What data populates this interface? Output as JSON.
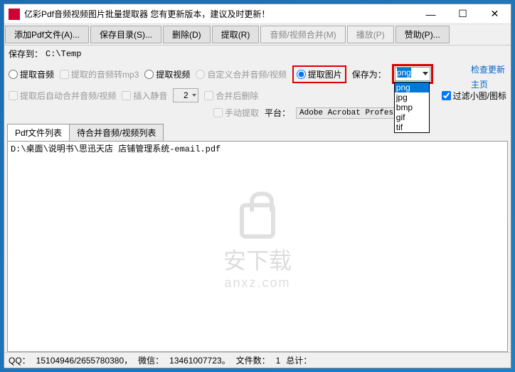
{
  "window": {
    "title": "亿彩Pdf音频视频图片批量提取器   您有更新版本，建议及时更新！"
  },
  "toolbar": {
    "add_pdf": "添加Pdf文件(A)...",
    "save_dir": "保存目录(S)...",
    "delete": "删除(D)",
    "extract": "提取(R)",
    "merge_av": "音频/视频合并(M)",
    "play": "播放(P)",
    "sponsor": "赞助(P)..."
  },
  "options": {
    "save_to_label": "保存到：",
    "save_to_path": "C:\\Temp",
    "extract_audio": "提取音频",
    "audio_to_mp3": "提取的音频转mp3",
    "extract_video": "提取视频",
    "custom_merge_av": "自定义合并音频/视频",
    "extract_image": "提取图片",
    "save_as_label": "保存为：",
    "format_selected": "png",
    "formats": [
      "png",
      "jpg",
      "bmp",
      "gif",
      "tif"
    ],
    "auto_merge_after": "提取后自动合并音频/视频",
    "insert_silence": "插入静音",
    "silence_value": "2",
    "delete_after_merge": "合并后删除",
    "filter_small": "过滤小图/图标",
    "manual_extract": "手动提取",
    "platform_label": "平台：",
    "platform_value": "Adobe Acrobat Professio"
  },
  "links": {
    "check_update": "检查更新",
    "homepage": "主页"
  },
  "tabs": {
    "pdf_list": "Pdf文件列表",
    "merge_list": "待合并音频/视频列表"
  },
  "list": {
    "items": [
      "D:\\桌面\\说明书\\思迅天店 店铺管理系统-email.pdf"
    ]
  },
  "watermark": {
    "main": "安下载",
    "sub": "anxz.com"
  },
  "statusbar": {
    "qq_label": "QQ：",
    "qq": "15104946/2655780380，",
    "wechat_label": "微信：",
    "wechat": "13461007723。",
    "filecount_label": "文件数：",
    "filecount": "1",
    "total_label": "总计："
  }
}
